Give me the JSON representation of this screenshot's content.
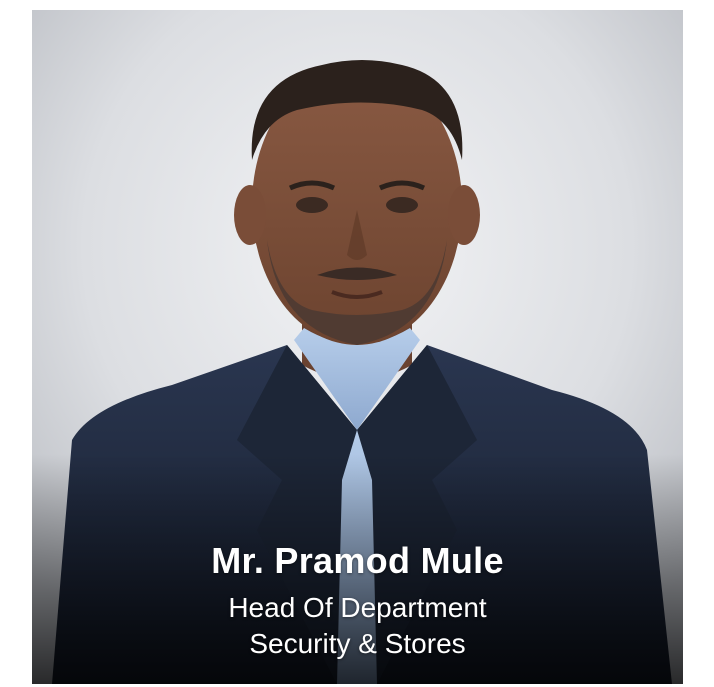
{
  "profile": {
    "name": "Mr. Pramod Mule",
    "title": "Head Of Department",
    "department": "Security & Stores"
  },
  "colors": {
    "background": "#e4e5e8",
    "suit": "#1f2a3d",
    "shirt": "#a9c3e3",
    "caption_text": "#ffffff"
  }
}
